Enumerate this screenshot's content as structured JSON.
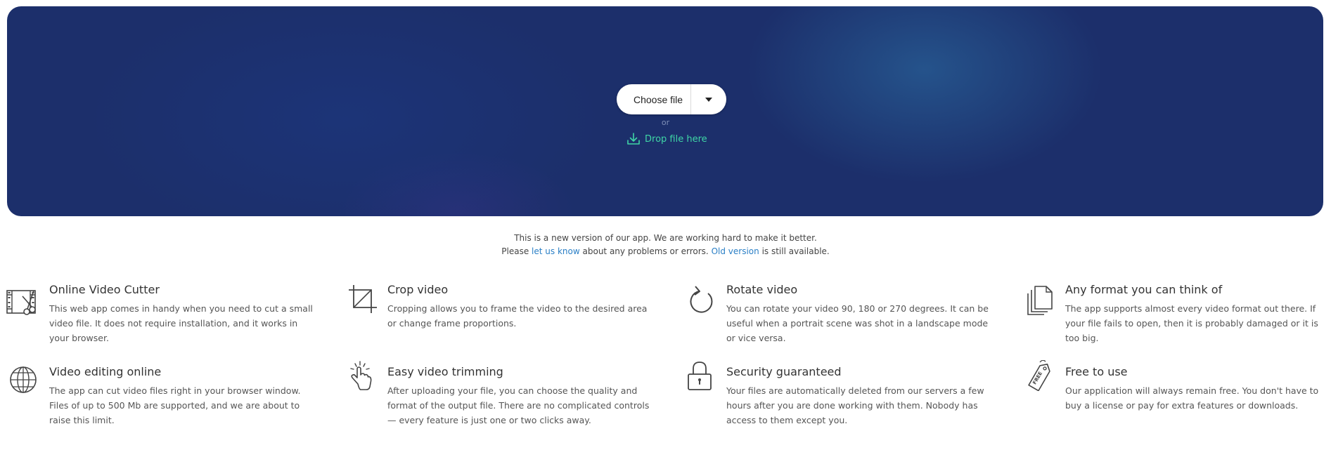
{
  "upload": {
    "choose_label": "Choose file",
    "or_label": "or",
    "drop_label": "Drop file here"
  },
  "notice": {
    "line1": "This is a new version of our app. We are working hard to make it better.",
    "line2_prefix": "Please",
    "link_feedback": "let us know",
    "line2_middle": "about any problems or errors.",
    "link_old": "Old version",
    "line2_suffix": "is still available."
  },
  "features": [
    {
      "icon": "film-scissors-icon",
      "title": "Online Video Cutter",
      "text": "This web app comes in handy when you need to cut a small video file. It does not require installation, and it works in your browser."
    },
    {
      "icon": "crop-icon",
      "title": "Crop video",
      "text": "Cropping allows you to frame the video to the desired area or change frame proportions."
    },
    {
      "icon": "rotate-icon",
      "title": "Rotate video",
      "text": "You can rotate your video 90, 180 or 270 degrees. It can be useful when a portrait scene was shot in a landscape mode or vice versa."
    },
    {
      "icon": "documents-icon",
      "title": "Any format you can think of",
      "text": "The app supports almost every video format out there. If your file fails to open, then it is probably damaged or it is too big."
    },
    {
      "icon": "globe-icon",
      "title": "Video editing online",
      "text": "The app can cut video files right in your browser window. Files of up to 500 Mb are supported, and we are about to raise this limit."
    },
    {
      "icon": "hand-click-icon",
      "title": "Easy video trimming",
      "text": "After uploading your file, you can choose the quality and format of the output file. There are no complicated controls — every feature is just one or two clicks away."
    },
    {
      "icon": "lock-icon",
      "title": "Security guaranteed",
      "text": "Your files are automatically deleted from our servers a few hours after you are done working with them. Nobody has access to them except you."
    },
    {
      "icon": "free-tag-icon",
      "title": "Free to use",
      "text": "Our application will always remain free. You don't have to buy a license or pay for extra features or downloads.",
      "tag_text": "FREE"
    }
  ],
  "colors": {
    "hero_bg": "#1c2f6b",
    "drop_link": "#3fd6a6",
    "notice_link": "#2a7fc6"
  }
}
